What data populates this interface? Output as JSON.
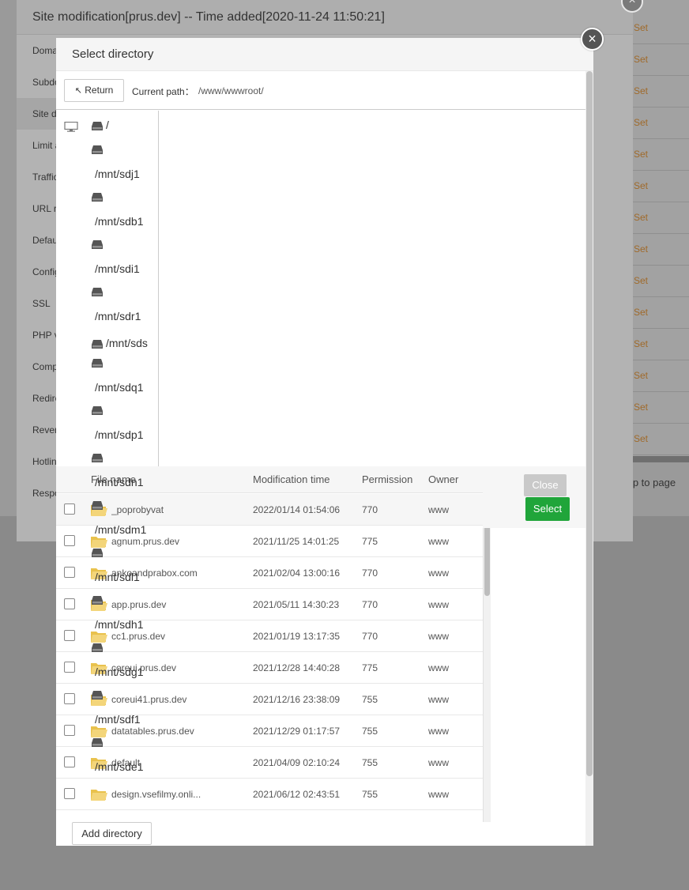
{
  "background": {
    "row_action_label": "Set",
    "jump_to_page": "mp to page",
    "close_symbol": "×"
  },
  "site_dialog": {
    "title": "Site modification[prus.dev] -- Time added[2020-11-24 11:50:21]",
    "nav": [
      "Domain",
      "Subdomain",
      "Site directory",
      "Limit access",
      "Traffic limit",
      "URL rewrite",
      "Default document",
      "Config",
      "SSL",
      "PHP version",
      "Composer",
      "Redirect",
      "Reverse proxy",
      "Hotlink protection",
      "Response log"
    ]
  },
  "dir_dialog": {
    "title": "Select directory",
    "close_symbol": "×",
    "return_label": "Return",
    "return_arrow": "🡄",
    "current_path_label": "Current path：",
    "current_path": "/www/wwwroot/",
    "tree": [
      "/",
      "/mnt/sdj1",
      "/mnt/sdb1",
      "/mnt/sdi1",
      "/mnt/sdr1",
      "/mnt/sds",
      "/mnt/sdq1",
      "/mnt/sdp1",
      "/mnt/sdn1",
      "/mnt/sdm1",
      "/mnt/sdl1",
      "/mnt/sdh1",
      "/mnt/sdg1",
      "/mnt/sdf1",
      "/mnt/sde1"
    ],
    "columns": {
      "name": "File name",
      "time": "Modification time",
      "perm": "Permission",
      "owner": "Owner"
    },
    "files": [
      {
        "name": "_poprobyvat",
        "time": "2022/01/14 01:54:06",
        "perm": "770",
        "owner": "www"
      },
      {
        "name": "agnum.prus.dev",
        "time": "2021/11/25 14:01:25",
        "perm": "775",
        "owner": "www"
      },
      {
        "name": "ankoandprabox.com",
        "time": "2021/02/04 13:00:16",
        "perm": "770",
        "owner": "www"
      },
      {
        "name": "app.prus.dev",
        "time": "2021/05/11 14:30:23",
        "perm": "770",
        "owner": "www"
      },
      {
        "name": "cc1.prus.dev",
        "time": "2021/01/19 13:17:35",
        "perm": "770",
        "owner": "www"
      },
      {
        "name": "coreui.prus.dev",
        "time": "2021/12/28 14:40:28",
        "perm": "775",
        "owner": "www"
      },
      {
        "name": "coreui41.prus.dev",
        "time": "2021/12/16 23:38:09",
        "perm": "755",
        "owner": "www"
      },
      {
        "name": "datatables.prus.dev",
        "time": "2021/12/29 01:17:57",
        "perm": "755",
        "owner": "www"
      },
      {
        "name": "default",
        "time": "2021/04/09 02:10:24",
        "perm": "755",
        "owner": "www"
      },
      {
        "name": "design.vsefilmy.onli...",
        "time": "2021/06/12 02:43:51",
        "perm": "755",
        "owner": "www"
      }
    ],
    "close_label": "Close",
    "select_label": "Select",
    "add_directory_label": "Add directory"
  }
}
